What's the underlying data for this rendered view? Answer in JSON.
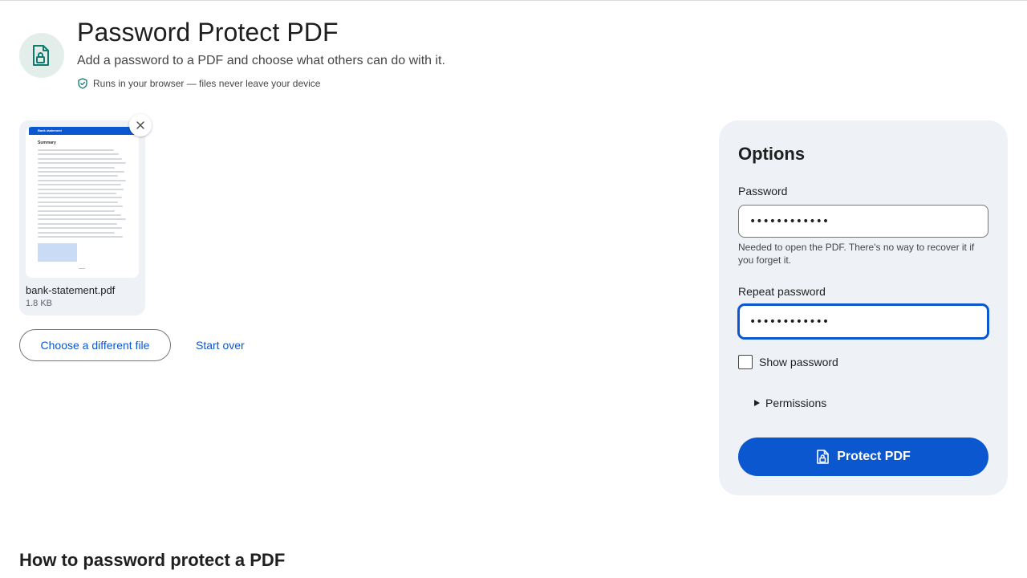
{
  "header": {
    "title": "Password Protect PDF",
    "subtitle": "Add a password to a PDF and choose what others can do with it.",
    "privacy_note": "Runs in your browser — files never leave your device",
    "icon": "file-lock-icon",
    "accent_color": "#0f7b6c"
  },
  "file": {
    "name": "bank-statement.pdf",
    "size": "1.8 KB",
    "thumbnail": {
      "header_text": "Bank statement",
      "heading": "Summary"
    }
  },
  "actions": {
    "choose_file": "Choose a different file",
    "start_over": "Start over"
  },
  "options": {
    "title": "Options",
    "password_label": "Password",
    "password_value": "••••••••••••",
    "password_help": "Needed to open the PDF. There's no way to recover it if you forget it.",
    "repeat_label": "Repeat password",
    "repeat_value": "••••••••••••",
    "show_password_label": "Show password",
    "show_password_checked": false,
    "permissions_label": "Permissions",
    "submit_label": "Protect PDF"
  },
  "how_to": {
    "heading": "How to password protect a PDF"
  },
  "colors": {
    "primary": "#0b57d0",
    "panel_bg": "#eef2f7",
    "icon_circle_bg": "#e3eeea"
  }
}
